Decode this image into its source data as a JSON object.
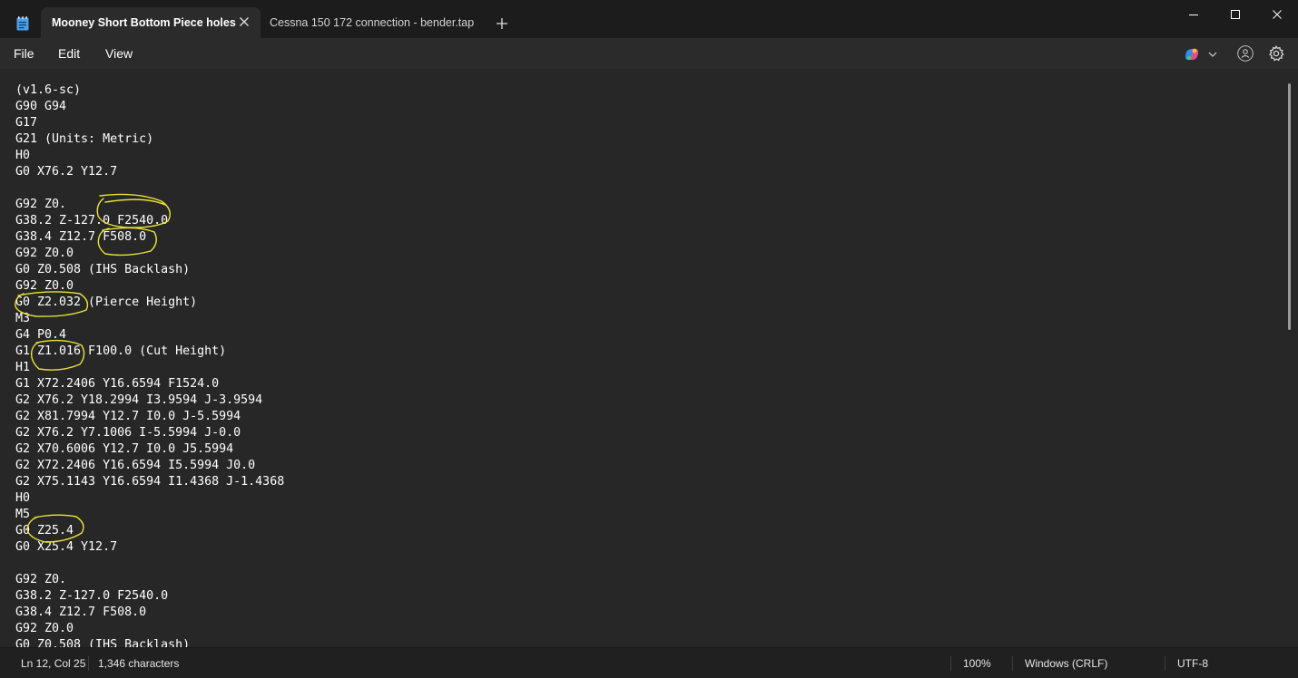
{
  "tabs": [
    {
      "label": "Mooney Short Bottom Piece holes",
      "active": true
    },
    {
      "label": "Cessna 150 172 connection - bender.tap",
      "active": false
    }
  ],
  "menu": {
    "file": "File",
    "edit": "Edit",
    "view": "View"
  },
  "icons": {
    "app": "notepad-icon",
    "tab_close": "close-icon",
    "new_tab": "plus-icon",
    "minimize": "minimize-icon",
    "maximize": "maximize-icon",
    "close": "close-icon",
    "copilot": "copilot-icon",
    "account": "account-icon",
    "settings": "gear-icon"
  },
  "editor": {
    "text": "(v1.6-sc)\nG90 G94\nG17\nG21 (Units: Metric)\nH0\nG0 X76.2 Y12.7\n\nG92 Z0.\nG38.2 Z-127.0 F2540.0\nG38.4 Z12.7 F508.0\nG92 Z0.0\nG0 Z0.508 (IHS Backlash)\nG92 Z0.0\nG0 Z2.032 (Pierce Height)\nM3\nG4 P0.4\nG1 Z1.016 F100.0 (Cut Height)\nH1\nG1 X72.2406 Y16.6594 F1524.0\nG2 X76.2 Y18.2994 I3.9594 J-3.9594\nG2 X81.7994 Y12.7 I0.0 J-5.5994\nG2 X76.2 Y7.1006 I-5.5994 J-0.0\nG2 X70.6006 Y12.7 I0.0 J5.5994\nG2 X72.2406 Y16.6594 I5.5994 J0.0\nG2 X75.1143 Y16.6594 I1.4368 J-1.4368\nH0\nM5\nG0 Z25.4\nG0 X25.4 Y12.7\n\nG92 Z0.\nG38.2 Z-127.0 F2540.0\nG38.4 Z12.7 F508.0\nG92 Z0.0\nG0 Z0.508 (IHS Backlash)"
  },
  "status": {
    "position": "Ln 12, Col 25",
    "characters": "1,346 characters",
    "zoom": "100%",
    "line_ending": "Windows (CRLF)",
    "encoding": "UTF-8"
  },
  "colors": {
    "annotation": "#e8e23a",
    "background": "#272727",
    "text": "#ffffff"
  }
}
